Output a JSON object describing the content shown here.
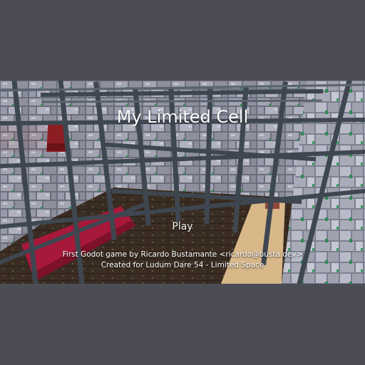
{
  "game": {
    "title": "My Limited Cell",
    "menu": {
      "play_label": "Play"
    },
    "credits": {
      "line1": "First Godot game by Ricardo Bustamante <ricardo@busta.dev>",
      "line2": "Created for Ludum Dare 54 - Limited Space"
    }
  },
  "colors": {
    "letterbox": "#4c4c55",
    "stone": "#9a9caa",
    "stone_dark": "#5f616e",
    "moss": "#3d8a5a",
    "floor": "#3a2c22",
    "bars": "#3e4650",
    "red_block": "#a8183a"
  }
}
